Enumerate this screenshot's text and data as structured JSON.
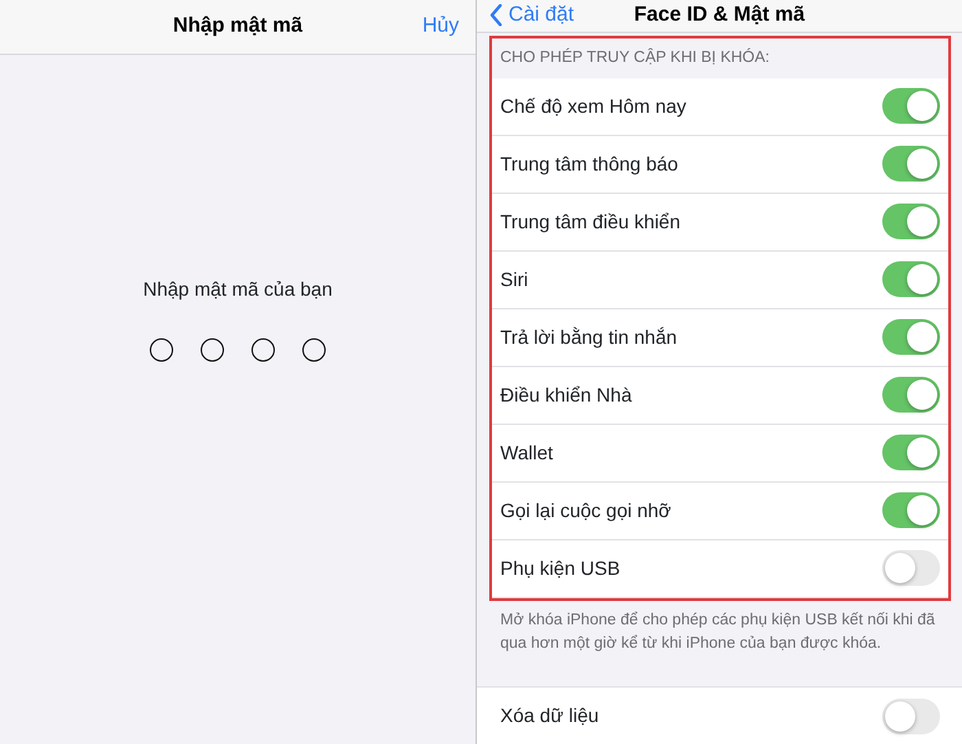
{
  "passcode_panel": {
    "title": "Nhập mật mã",
    "cancel": "Hủy",
    "prompt": "Nhập mật mã của bạn",
    "dots": [
      {
        "filled": false
      },
      {
        "filled": false
      },
      {
        "filled": false
      },
      {
        "filled": false
      }
    ]
  },
  "settings_panel": {
    "back": "Cài đặt",
    "title": "Face ID & Mật mã",
    "section_header": "CHO PHÉP TRUY CẬP KHI BỊ KHÓA:",
    "items": [
      {
        "label": "Chế độ xem Hôm nay",
        "on": true
      },
      {
        "label": "Trung tâm thông báo",
        "on": true
      },
      {
        "label": "Trung tâm điều khiển",
        "on": true
      },
      {
        "label": "Siri",
        "on": true
      },
      {
        "label": "Trả lời bằng tin nhắn",
        "on": true
      },
      {
        "label": "Điều khiển Nhà",
        "on": true
      },
      {
        "label": "Wallet",
        "on": true
      },
      {
        "label": "Gọi lại cuộc gọi nhỡ",
        "on": true
      },
      {
        "label": "Phụ kiện USB",
        "on": false
      }
    ],
    "footer": "Mở khóa iPhone để cho phép các phụ kiện USB kết nối khi đã qua hơn một giờ kể từ khi iPhone của bạn được khóa.",
    "erase": {
      "label": "Xóa dữ liệu",
      "on": false
    }
  }
}
